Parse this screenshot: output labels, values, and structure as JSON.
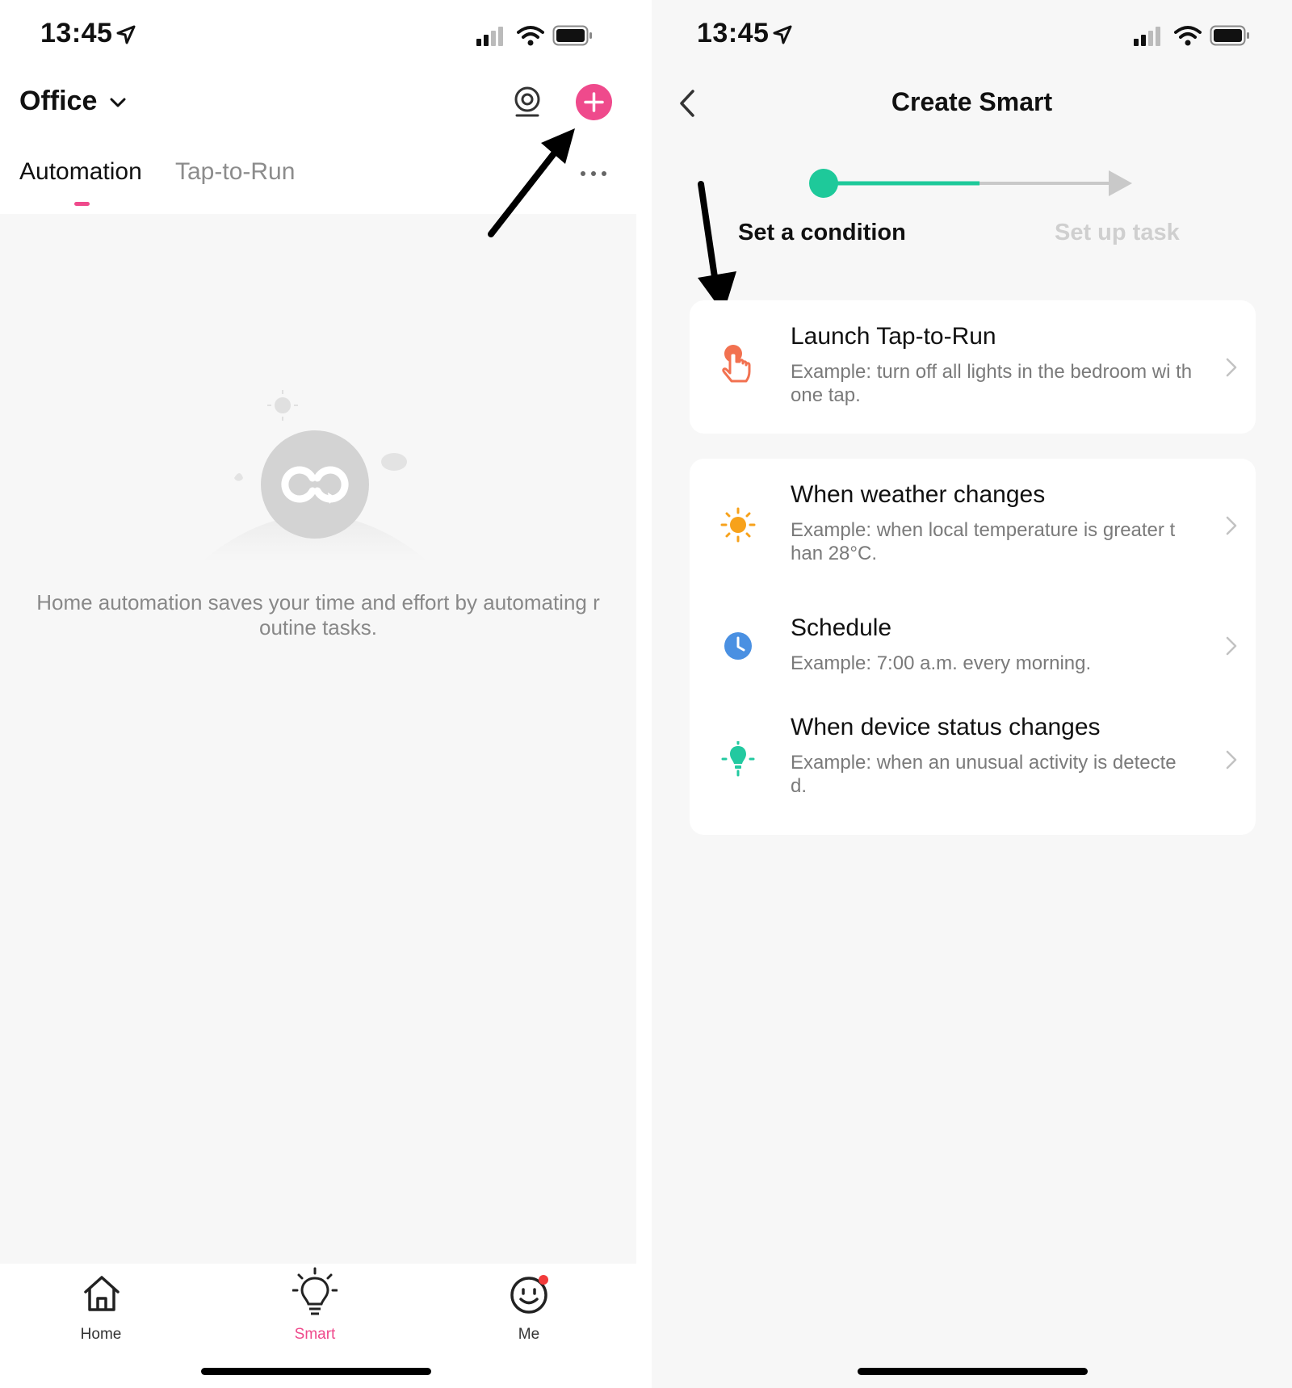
{
  "left": {
    "status": {
      "time": "13:45"
    },
    "header": {
      "home_name": "Office",
      "tabs": [
        {
          "label": "Automation",
          "active": true
        },
        {
          "label": "Tap-to-Run",
          "active": false
        }
      ]
    },
    "empty_state": {
      "message": "Home automation saves your time and effort by automating r outine tasks."
    },
    "bottom_nav": [
      {
        "label": "Home",
        "icon": "home-icon",
        "active": false
      },
      {
        "label": "Smart",
        "icon": "lightbulb-icon",
        "active": true
      },
      {
        "label": "Me",
        "icon": "face-icon",
        "active": false,
        "badge": true
      }
    ]
  },
  "right": {
    "status": {
      "time": "13:45"
    },
    "title": "Create Smart",
    "steps": [
      {
        "label": "Set a condition",
        "active": true
      },
      {
        "label": "Set up task",
        "active": false
      }
    ],
    "progress": 0.5,
    "cards": [
      {
        "rows": [
          {
            "icon": "tap-hand-icon",
            "title": "Launch Tap-to-Run",
            "subtitle": "Example: turn off all lights in the bedroom wi th one tap."
          }
        ]
      },
      {
        "rows": [
          {
            "icon": "sun-icon",
            "title": "When weather changes",
            "subtitle": "Example: when local temperature is greater t han 28°C."
          },
          {
            "icon": "clock-icon",
            "title": "Schedule",
            "subtitle": "Example: 7:00 a.m. every morning."
          },
          {
            "icon": "device-bulb-icon",
            "title": "When device status changes",
            "subtitle": "Example: when an unusual activity is detecte d."
          }
        ]
      }
    ]
  },
  "colors": {
    "accent_pink": "#ef4a8c",
    "progress_green": "#1ec99a",
    "sun_orange": "#f7a21b",
    "tap_orange": "#f27150",
    "clock_blue": "#4a90e2",
    "device_green": "#22c9a0",
    "badge_red": "#f23b3b"
  }
}
